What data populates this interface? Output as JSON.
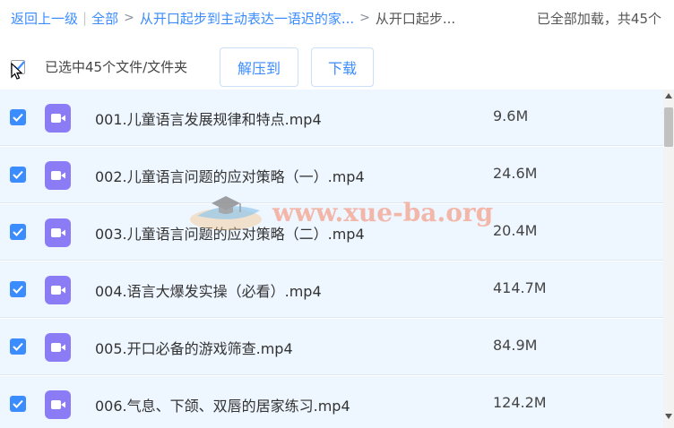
{
  "breadcrumb": {
    "back_label": "返回上一级",
    "all_label": "全部",
    "folder_label": "从开口起步到主动表达一语迟的家...",
    "current_label": "从开口起步...",
    "separator_bar": "|",
    "separator_arrow": ">"
  },
  "status": {
    "loaded_text": "已全部加载，共45个"
  },
  "toolbar": {
    "selected_text": "已选中45个文件/文件夹",
    "extract_label": "解压到",
    "download_label": "下载"
  },
  "files": [
    {
      "name": "001.儿童语言发展规律和特点.mp4",
      "size": "9.6M"
    },
    {
      "name": "002.儿童语言问题的应对策略（一）.mp4",
      "size": "24.6M"
    },
    {
      "name": "003.儿童语言问题的应对策略（二）.mp4",
      "size": "20.4M"
    },
    {
      "name": "004.语言大爆发实操（必看）.mp4",
      "size": "414.7M"
    },
    {
      "name": "005.开口必备的游戏筛查.mp4",
      "size": "84.9M"
    },
    {
      "name": "006.气息、下颌、双唇的居家练习.mp4",
      "size": "124.2M"
    }
  ],
  "watermark": {
    "text": "www.xue-ba.org"
  },
  "colors": {
    "accent": "#3b8cff",
    "row_bg": "#eef6ff",
    "video_icon": "#8b7cf6"
  }
}
